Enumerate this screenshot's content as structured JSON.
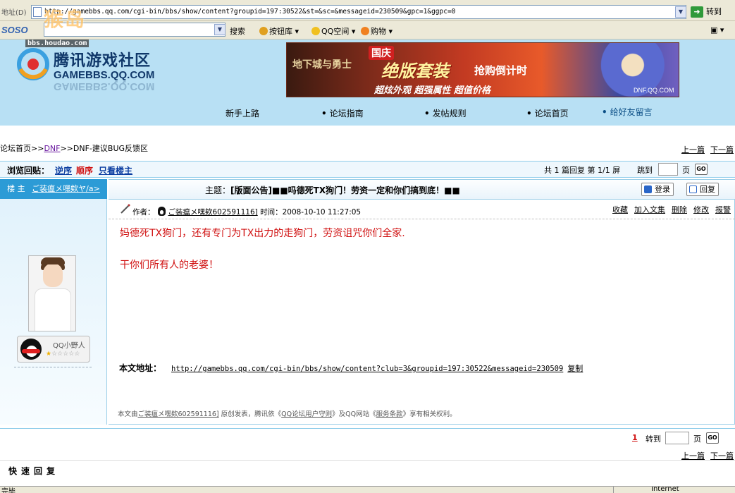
{
  "browser": {
    "address_label": "地址(D)",
    "url": "http://gamebbs.qq.com/cgi-bin/bbs/show/content?groupid=197:30522&st=&sc=&messageid=230509&gpc=1&ggpc=0",
    "go_label": "转到",
    "toolbar": {
      "logo": "SOSO",
      "search_label": "搜索",
      "items": [
        "按钮库",
        "QQ空间",
        "购物"
      ]
    },
    "status_text": "完毕",
    "status_zone": "Internet"
  },
  "watermark": {
    "text": "猴岛",
    "url": "bbs.houdao.com"
  },
  "header": {
    "logo_cn": "腾讯游戏社区",
    "logo_en": "GAMEBBS.QQ.COM",
    "banner": {
      "game": "地下城与勇士",
      "badge": "国庆",
      "headline": "绝版套装",
      "headline2": "抢购倒计时",
      "tagline": "超炫外观 超强属性 超值价格",
      "site": "DNF.QQ.COM"
    },
    "nav": [
      "新手上路",
      "论坛指南",
      "发帖规则",
      "论坛首页",
      "给好友留言"
    ]
  },
  "breadcrumb": {
    "home": "论坛首页",
    "sep": ">>",
    "board": "DNF",
    "section": "DNF-建议BUG反馈区"
  },
  "prevnext": {
    "prev": "上一篇",
    "next": "下一篇"
  },
  "sortbar": {
    "label": "浏览回贴：",
    "reverse": "逆序",
    "forward": "顺序",
    "host_only": "只看楼主",
    "summary": "共 1 篇回复 第 1/1 屏",
    "jump": "跳到",
    "page": "页",
    "go": "GO"
  },
  "author": {
    "floor": "楼 主",
    "name": "ご装瘟メ嘿欸ヤ/a>",
    "qq_label": "QQ小野人",
    "stars": 1,
    "max_stars": 6
  },
  "post": {
    "title_prefix": "主题：",
    "title_tag": "[版面公告]",
    "title_text": "■■吗德死TX狗门！劳资一定和你们搞到底！■■",
    "login": "登录",
    "reply": "回复",
    "author_label": "作者：",
    "author_name": "ご装瘟メ嘿欸602591116]",
    "time_label": "时间：",
    "time": "2008-10-10 11:27:05",
    "actions": [
      "收藏",
      "加入文集",
      "删除",
      "修改",
      "报警"
    ],
    "body_line1": "妈德死TX狗门，还有专门为TX出力的走狗门，劳资诅咒你们全家.",
    "body_line2": "干你们所有人的老婆！",
    "address_label": "本文地址：",
    "address_url": "http://gamebbs.qq.com/cgi-bin/bbs/show/content?club=3&groupid=197:30522&messageid=230509",
    "copy": "复制",
    "notice_prefix": "本文由",
    "notice_author": "ご装瘟メ嘿欸602591116]",
    "notice_mid": " 原创发表，腾讯依《",
    "notice_rule": "QQ论坛用户守则",
    "notice_mid2": "》及QQ网站《",
    "notice_terms": "服务条款",
    "notice_end": "》享有相关权利。"
  },
  "bottom": {
    "current_page": "1",
    "goto": "转到",
    "page": "页",
    "go": "GO",
    "quick_reply": "快速回复"
  }
}
